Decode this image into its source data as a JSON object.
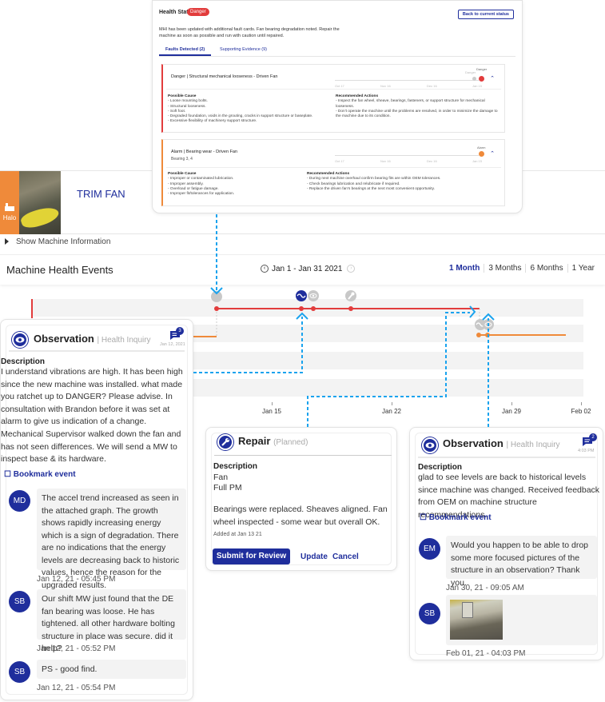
{
  "health_status": {
    "title": "Health Status",
    "badge": "Danger",
    "back_button": "Back to current status",
    "description": "MHI has been updated with additional fault cards. Fan bearing degradation noted. Repair the machine as soon as possible and run with caution until repaired.",
    "tabs": [
      {
        "label": "Faults Detected (2)",
        "active": true
      },
      {
        "label": "Supporting Evidence (9)",
        "active": false
      }
    ],
    "faults": [
      {
        "title": "Danger | Structural mechanical looseness - Driven Fan",
        "subtitle": "",
        "severity": "Danger",
        "color": "#e23c3c",
        "mini_timeline": {
          "ticks": [
            "Oct 17",
            "Nov 16",
            "Dec 16",
            "Jan 15"
          ],
          "markers": [
            {
              "label": "Danger",
              "state": "previous"
            },
            {
              "label": "Danger",
              "state": "current"
            }
          ]
        },
        "cause_heading": "Possible Cause",
        "causes": [
          "- Loose mounting bolts.",
          "- Structural looseness.",
          "- Soft foot.",
          "- Degraded foundation, voids in the grouting, cracks in support structure or baseplate.",
          "- Excessive flexibility of machinery support structure."
        ],
        "actions_heading": "Recommended Actions",
        "actions": [
          "- Inspect the fan wheel, sheave, bearings, fasteners, or support structure for mechanical looseness.",
          "- Don't operate the machine until the problems are resolved, in order to minimize the damage to the machine due to its condition."
        ]
      },
      {
        "title": "Alarm | Bearing wear - Driven Fan",
        "subtitle": "Bearing 3, 4",
        "severity": "Alarm",
        "color": "#ef8a3a",
        "mini_timeline": {
          "ticks": [
            "Oct 17",
            "Nov 16",
            "Dec 16",
            "Jan 15"
          ],
          "markers": [
            {
              "label": "Alarm",
              "state": "current"
            }
          ]
        },
        "cause_heading": "Possible Cause",
        "causes": [
          "- Improper or contaminated lubrication.",
          "- Improper assembly.",
          "- Overload or fatigue damage.",
          "- Improper fit/tolerances for application."
        ],
        "actions_heading": "Recommended Actions",
        "actions": [
          "- During next machine overhaul confirm bearing fits are within OEM tolerances.",
          "- Check bearings lubrication and relubricate if required.",
          "- Replace the driven fan's bearings at the next most convenient opportunity."
        ]
      }
    ]
  },
  "machine": {
    "name": "TRIM FAN",
    "tab_label": "Halo",
    "tab_color": "#ef8a3a",
    "show_info_label": "Show Machine Information"
  },
  "events": {
    "title": "Machine Health Events",
    "date_range": "Jan 1 - Jan 31 2021",
    "range_options": [
      "1 Month",
      "3 Months",
      "6 Months",
      "1 Year"
    ],
    "selected_range": "1 Month",
    "axis_ticks": [
      "Jan 15",
      "Jan 22",
      "Jan 29",
      "Feb 02"
    ],
    "danger_color": "#e23c3c",
    "alarm_color": "#ef8a3a"
  },
  "observation_left": {
    "title": "Observation",
    "subtitle": "| Health Inquiry",
    "comment_count": "3",
    "date": "Jan 12, 2021",
    "description_label": "Description",
    "description": "I understand vibrations are high. It has been high since the new machine was installed. what made you ratchet up to DANGER? Please advise. In consultation with Brandon before it was set at alarm to give us indication of a change.",
    "description_2": "Mechanical Supervisor walked down the fan and has not seen differences. We will send a MW to inspect base & its hardware.",
    "bookmark_label": "Bookmark event",
    "comments": [
      {
        "initials": "MD",
        "text": " The accel trend increased as seen in the attached graph. The growth shows rapidly increasing energy which is a sign of degradation. There are no indications that the energy levels are decreasing back to historic values, hence the reason for the upgraded results.",
        "time": "Jan 12, 21 - 05:45 PM"
      },
      {
        "initials": "SB",
        "text": "Our shift MW just found that the DE fan bearing was loose. He has tightened. all other hardware bolting structure in place was secure. did it help?",
        "time": "Jan 12, 21 - 05:52 PM"
      },
      {
        "initials": "SB",
        "text": "PS - good find.",
        "time": "Jan 12, 21 - 05:54 PM"
      }
    ]
  },
  "repair": {
    "title": "Repair",
    "subtitle": "(Planned)",
    "description_label": "Description",
    "lines": [
      "Fan",
      "Full PM"
    ],
    "body": "Bearings were replaced. Sheaves aligned. Fan wheel inspected - some wear but overall OK.",
    "added_at": "Added at Jan 13 21",
    "submit_label": "Submit for Review",
    "update_label": "Update",
    "cancel_label": "Cancel"
  },
  "observation_right": {
    "title": "Observation",
    "subtitle": "| Health Inquiry",
    "comment_count": "2",
    "date": "4:03 PM",
    "description_label": "Description",
    "description": "glad to see levels are back to historical levels since machine was changed. Received feedback from OEM on machine structure recommendations.",
    "bookmark_label": "Bookmark event",
    "comments": [
      {
        "initials": "EM",
        "text": "Would you happen to be able to drop some more focused pictures of the structure in an observation? Thank you.",
        "time": "Jan 30, 21 - 09:05 AM"
      },
      {
        "initials": "SB",
        "text": "",
        "attachment": "photo",
        "time": "Feb 01, 21 - 04:03 PM"
      }
    ]
  }
}
